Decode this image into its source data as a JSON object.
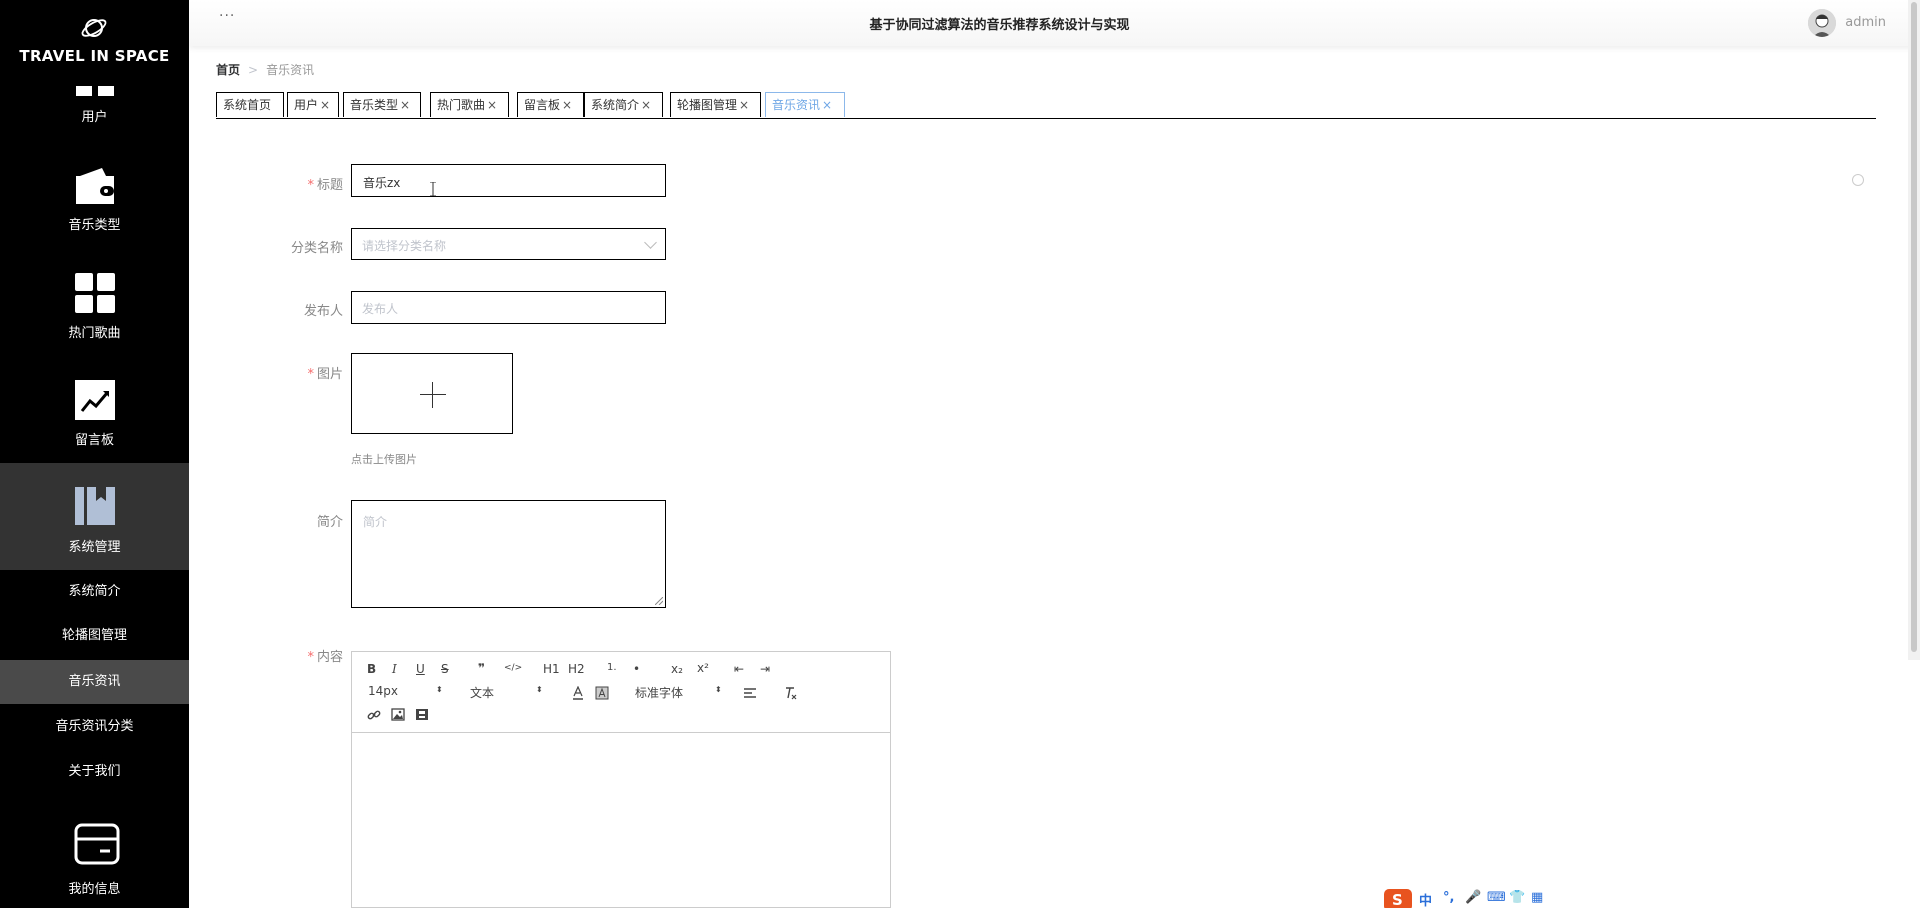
{
  "logo": {
    "title": "TRAVEL IN SPACE",
    "icon": "planet-icon"
  },
  "sidebar": {
    "items": [
      {
        "label": "用户",
        "icon": "users-grid-icon"
      },
      {
        "label": "音乐类型",
        "icon": "wallet-icon"
      },
      {
        "label": "热门歌曲",
        "icon": "grid-icon"
      },
      {
        "label": "留言板",
        "icon": "trend-chart-icon"
      },
      {
        "label": "系统管理",
        "icon": "book-icon"
      },
      {
        "label": "我的信息",
        "icon": "card-icon"
      }
    ],
    "subitems": [
      "系统简介",
      "轮播图管理",
      "音乐资讯",
      "音乐资讯分类",
      "关于我们"
    ]
  },
  "header": {
    "menu_icon": "···",
    "title": "基于协同过滤算法的音乐推荐系统设计与实现",
    "username": "admin"
  },
  "breadcrumb": {
    "home": "首页",
    "current": "音乐资讯"
  },
  "tabs": [
    {
      "label": "系统首页",
      "closable": false
    },
    {
      "label": "用户",
      "closable": true
    },
    {
      "label": "音乐类型",
      "closable": true
    },
    {
      "label": "热门歌曲",
      "closable": true
    },
    {
      "label": "留言板",
      "closable": true
    },
    {
      "label": "系统简介",
      "closable": true
    },
    {
      "label": "轮播图管理",
      "closable": true
    },
    {
      "label": "音乐资讯",
      "closable": true,
      "active": true
    }
  ],
  "form": {
    "title": {
      "label": "标题",
      "value": "音乐zx",
      "required": true
    },
    "category": {
      "label": "分类名称",
      "placeholder": "请选择分类名称"
    },
    "publisher": {
      "label": "发布人",
      "placeholder": "发布人"
    },
    "image": {
      "label": "图片",
      "required": true,
      "hint": "点击上传图片"
    },
    "summary": {
      "label": "简介",
      "placeholder": "简介"
    },
    "content": {
      "label": "内容",
      "required": true
    }
  },
  "editor": {
    "font_size": "14px",
    "block_type": "文本",
    "font_family": "标准字体",
    "buttons": [
      "B",
      "I",
      "U",
      "S",
      "❞",
      "</>",
      "H1",
      "H2",
      "1.",
      "•",
      "x₂",
      "x²",
      "⇤",
      "⇥"
    ]
  },
  "colors": {
    "sidebar_bg": "#000000",
    "sidebar_active": "#4a4a4a",
    "accent": "#6fa7e6",
    "required": "#f56c6c"
  }
}
